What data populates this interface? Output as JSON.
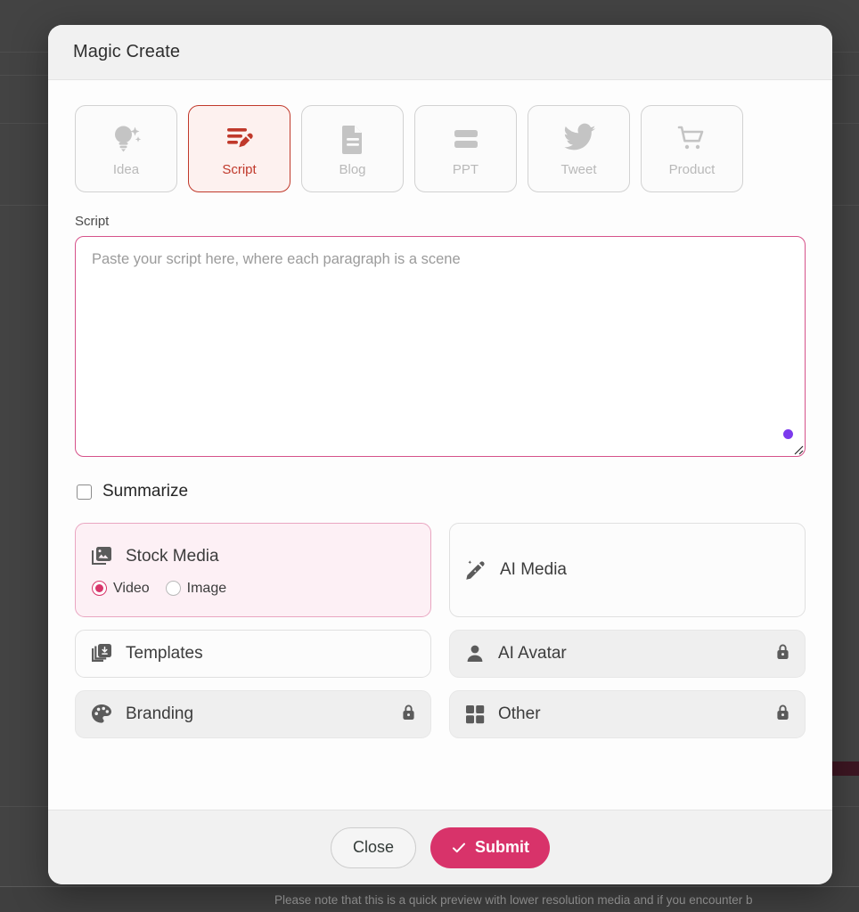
{
  "background": {
    "note": "Please note that this is a quick preview with lower resolution media and if you encounter b"
  },
  "modal": {
    "title": "Magic Create",
    "type_tabs": [
      {
        "label": "Idea",
        "icon": "lightbulb-sparkle-icon",
        "active": false
      },
      {
        "label": "Script",
        "icon": "script-pencil-icon",
        "active": true
      },
      {
        "label": "Blog",
        "icon": "document-icon",
        "active": false
      },
      {
        "label": "PPT",
        "icon": "slides-icon",
        "active": false
      },
      {
        "label": "Tweet",
        "icon": "twitter-bird-icon",
        "active": false
      },
      {
        "label": "Product",
        "icon": "shopping-cart-icon",
        "active": false
      }
    ],
    "script_field": {
      "label": "Script",
      "placeholder": "Paste your script here, where each paragraph is a scene",
      "value": ""
    },
    "summarize": {
      "label": "Summarize",
      "checked": false
    },
    "options": [
      {
        "label": "Stock Media",
        "icon": "stock-media-image-icon",
        "selected": true,
        "locked": false,
        "radios": [
          {
            "label": "Video",
            "checked": true
          },
          {
            "label": "Image",
            "checked": false
          }
        ]
      },
      {
        "label": "AI Media",
        "icon": "magic-wand-icon",
        "selected": false,
        "locked": false
      },
      {
        "label": "Templates",
        "icon": "templates-icon",
        "selected": false,
        "locked": false
      },
      {
        "label": "AI Avatar",
        "icon": "person-icon",
        "selected": false,
        "locked": true
      },
      {
        "label": "Branding",
        "icon": "palette-icon",
        "selected": false,
        "locked": true
      },
      {
        "label": "Other",
        "icon": "grid-squares-icon",
        "selected": false,
        "locked": true
      }
    ],
    "footer": {
      "close_label": "Close",
      "submit_label": "Submit"
    }
  },
  "colors": {
    "accent_pink": "#d8336a",
    "active_tab_red": "#c0392b",
    "selected_card_bg": "#fdf0f5",
    "cursor_dot_purple": "#7c3aed",
    "overlay": "#434343"
  }
}
